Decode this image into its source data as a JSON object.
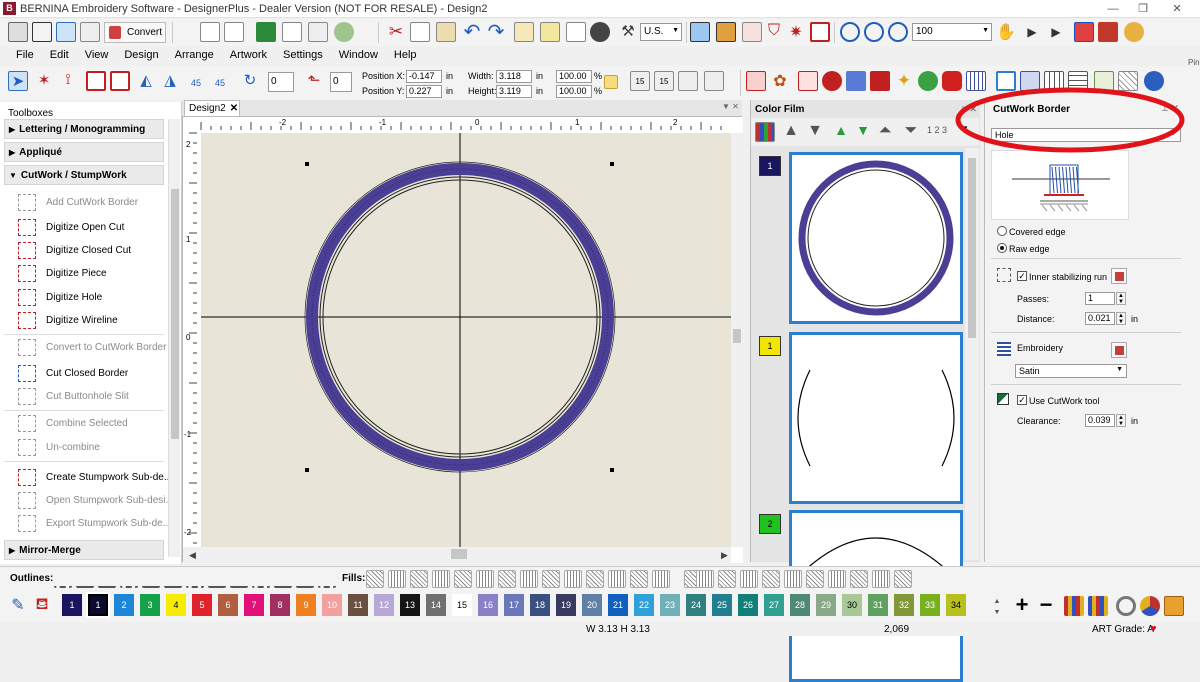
{
  "window": {
    "title": "BERNINA Embroidery Software - DesignerPlus - Dealer Version (NOT FOR RESALE) - Design2",
    "icon_letter": "B",
    "minimize": "—",
    "maximize": "❐",
    "close": "✕"
  },
  "toolbar1": {
    "convert_label": "Convert",
    "units_value": "U.S.",
    "zoom_value": "100"
  },
  "menu": [
    "File",
    "Edit",
    "View",
    "Design",
    "Arrange",
    "Artwork",
    "Settings",
    "Window",
    "Help"
  ],
  "toolbar2": {
    "rotate_left_label": "45",
    "rotate_right_label": "45",
    "angle1_value": "0",
    "angle2_value": "0",
    "position_x_label": "Position X:",
    "position_x_value": "-0.147",
    "position_x_unit": "in",
    "position_y_label": "Position Y:",
    "position_y_value": "0.227",
    "position_y_unit": "in",
    "width_label": "Width:",
    "width_value": "3.118",
    "width_unit": "in",
    "height_label": "Height:",
    "height_value": "3.119",
    "height_unit": "in",
    "scale_w_value": "100.00",
    "scale_h_value": "100.00",
    "pct": "%",
    "angle_a": "15",
    "angle_b": "15"
  },
  "toolboxes": {
    "title": "Toolboxes",
    "groups": {
      "lettering": "Lettering / Monogramming",
      "applique": "Appliqué",
      "cutwork": "CutWork / StumpWork",
      "mirror": "Mirror-Merge"
    },
    "items": [
      {
        "label": "Add CutWork Border",
        "disabled": true
      },
      {
        "label": "Digitize Open Cut",
        "disabled": false
      },
      {
        "label": "Digitize Closed Cut",
        "disabled": false
      },
      {
        "label": "Digitize Piece",
        "disabled": false
      },
      {
        "label": "Digitize Hole",
        "disabled": false
      },
      {
        "label": "Digitize Wireline",
        "disabled": false
      },
      {
        "label": "Convert to CutWork Border",
        "disabled": true
      },
      {
        "label": "Cut Closed Border",
        "disabled": false
      },
      {
        "label": "Cut Buttonhole Slit",
        "disabled": true
      },
      {
        "label": "Combine Selected",
        "disabled": true
      },
      {
        "label": "Un-combine",
        "disabled": true
      },
      {
        "label": "Create Stumpwork Sub-de...",
        "disabled": false
      },
      {
        "label": "Open Stumpwork Sub-desi...",
        "disabled": true
      },
      {
        "label": "Export Stumpwork Sub-de...",
        "disabled": true
      }
    ]
  },
  "document": {
    "tab_label": "Design2",
    "ruler_top": [
      "-2",
      "-1",
      "0",
      "1",
      "2"
    ],
    "ruler_left": [
      "2",
      "1",
      "0",
      "-1",
      "-2"
    ]
  },
  "color_film": {
    "title": "Color Film",
    "order_label": "1 2 3",
    "items": [
      {
        "number": "1",
        "badge_color": "#1a1560"
      },
      {
        "number": "1",
        "badge_color": "#f2e600"
      },
      {
        "number": "2",
        "badge_color": "#1fc21f"
      }
    ]
  },
  "cutwork_border": {
    "title": "CutWork Border",
    "type_value": "Hole",
    "covered_edge": "Covered edge",
    "raw_edge": "Raw edge",
    "inner_run": "Inner stabilizing run",
    "passes_label": "Passes:",
    "passes_value": "1",
    "distance_label": "Distance:",
    "distance_value": "0.021",
    "distance_unit": "in",
    "embroidery_label": "Embroidery",
    "stitch_type": "Satin",
    "use_tool": "Use CutWork tool",
    "clearance_label": "Clearance:",
    "clearance_value": "0.039",
    "clearance_unit": "in"
  },
  "right_edge_label": "Pin",
  "stitchbar": {
    "outlines_label": "Outlines:",
    "fills_label": "Fills:"
  },
  "palette": {
    "swatches": [
      {
        "n": "1",
        "c": "#1a1560",
        "t": "#ffffff"
      },
      {
        "n": "1",
        "c": "#0a0a2a",
        "t": "#ffffff"
      },
      {
        "n": "2",
        "c": "#1e86d8",
        "t": "#ffffff"
      },
      {
        "n": "3",
        "c": "#15a04a",
        "t": "#ffffff"
      },
      {
        "n": "4",
        "c": "#f6ec00",
        "t": "#000000"
      },
      {
        "n": "5",
        "c": "#e0222a",
        "t": "#ffffff"
      },
      {
        "n": "6",
        "c": "#b06040",
        "t": "#ffffff"
      },
      {
        "n": "7",
        "c": "#e2117a",
        "t": "#ffffff"
      },
      {
        "n": "8",
        "c": "#a03060",
        "t": "#ffffff"
      },
      {
        "n": "9",
        "c": "#ee8020",
        "t": "#ffffff"
      },
      {
        "n": "10",
        "c": "#f2a0a0",
        "t": "#ffffff"
      },
      {
        "n": "11",
        "c": "#6a5040",
        "t": "#ffffff"
      },
      {
        "n": "12",
        "c": "#b8a8d8",
        "t": "#ffffff"
      },
      {
        "n": "13",
        "c": "#151515",
        "t": "#ffffff"
      },
      {
        "n": "14",
        "c": "#707070",
        "t": "#ffffff"
      },
      {
        "n": "15",
        "c": "#ffffff",
        "t": "#000000"
      },
      {
        "n": "16",
        "c": "#8a80c8",
        "t": "#ffffff"
      },
      {
        "n": "17",
        "c": "#6878b8",
        "t": "#ffffff"
      },
      {
        "n": "18",
        "c": "#3a5080",
        "t": "#ffffff"
      },
      {
        "n": "19",
        "c": "#3a3a60",
        "t": "#ffffff"
      },
      {
        "n": "20",
        "c": "#6080a8",
        "t": "#ffffff"
      },
      {
        "n": "21",
        "c": "#1060c0",
        "t": "#ffffff"
      },
      {
        "n": "22",
        "c": "#30a0d8",
        "t": "#ffffff"
      },
      {
        "n": "23",
        "c": "#70b0b8",
        "t": "#ffffff"
      },
      {
        "n": "24",
        "c": "#308080",
        "t": "#ffffff"
      },
      {
        "n": "25",
        "c": "#208090",
        "t": "#ffffff"
      },
      {
        "n": "26",
        "c": "#108078",
        "t": "#ffffff"
      },
      {
        "n": "27",
        "c": "#30a090",
        "t": "#ffffff"
      },
      {
        "n": "28",
        "c": "#508878",
        "t": "#ffffff"
      },
      {
        "n": "29",
        "c": "#88a888",
        "t": "#ffffff"
      },
      {
        "n": "30",
        "c": "#a8c898",
        "t": "#000000"
      },
      {
        "n": "31",
        "c": "#60a060",
        "t": "#ffffff"
      },
      {
        "n": "32",
        "c": "#809838",
        "t": "#ffffff"
      },
      {
        "n": "33",
        "c": "#78b020",
        "t": "#ffffff"
      },
      {
        "n": "34",
        "c": "#b8c020",
        "t": "#000000"
      }
    ]
  },
  "status": {
    "dimensions": "W 3.13  H 3.13",
    "stitch_count": "2,069",
    "art_grade": "ART Grade: A"
  },
  "colors": {
    "design_thread": "#4b3f95",
    "highlight_ring": "#e0131a",
    "selection_blue": "#2a7fd0"
  }
}
